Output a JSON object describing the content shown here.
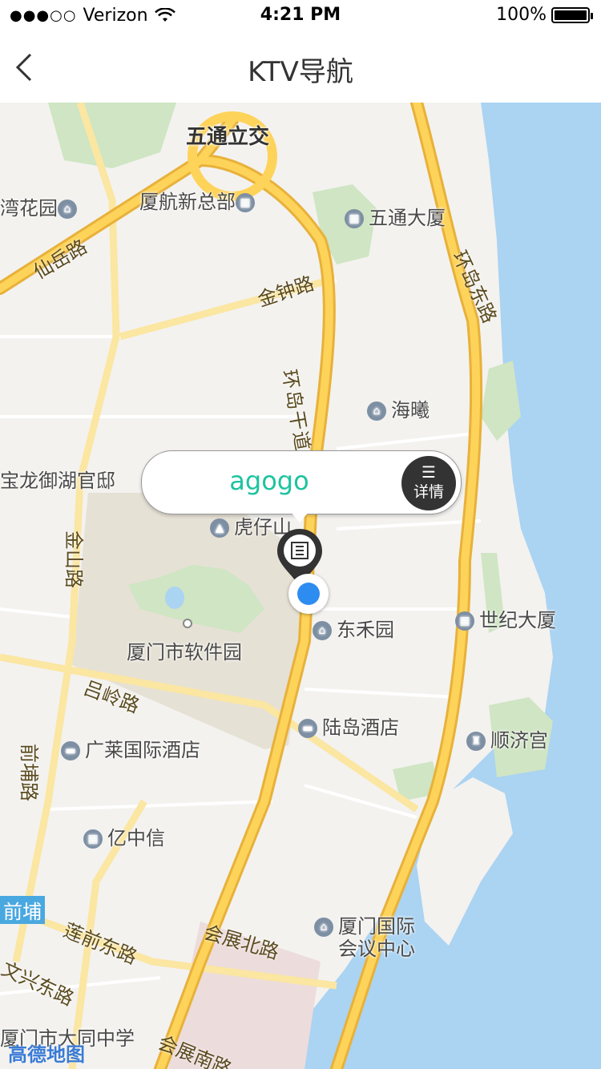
{
  "status_bar": {
    "carrier": "Verizon",
    "time": "4:21 PM",
    "battery": "100%"
  },
  "nav": {
    "title": "KTV导航"
  },
  "callout": {
    "name": "agogo",
    "detail_label": "详情"
  },
  "map_labels": {
    "wutong_lijiao": "五通立交",
    "xiamen_hangkong": "厦航新总部",
    "wan_huayuan": "湾花园",
    "wutong_dasha": "五通大厦",
    "haixi": "海曦",
    "baolong": "宝龙御湖官邸",
    "huzaishan": "虎仔山",
    "donghe": "东禾园",
    "software_park": "厦门市软件园",
    "shiji_dasha": "世纪大厦",
    "ludao_hotel": "陆岛酒店",
    "shunjigong": "顺济宫",
    "guanglai_hotel": "广莱国际酒店",
    "yizhongxin": "亿中信",
    "conference_center_1": "厦门国际",
    "conference_center_2": "会议中心",
    "datong_school": "厦门市大同中学",
    "qianpu_badge": "前埔"
  },
  "road_labels": {
    "xianyue": "仙岳路",
    "jinzhong": "金钟路",
    "huandao_gan": "环岛干道",
    "huandao_dong": "环岛东路",
    "jinshan": "金山路",
    "lvling": "吕岭路",
    "qianpu_road": "前埔路",
    "lianqian_dong": "莲前东路",
    "huizhan_bei": "会展北路",
    "wenxing_dong": "文兴东路",
    "huizhan_nan": "会展南路"
  },
  "map_logo": "高德地图"
}
